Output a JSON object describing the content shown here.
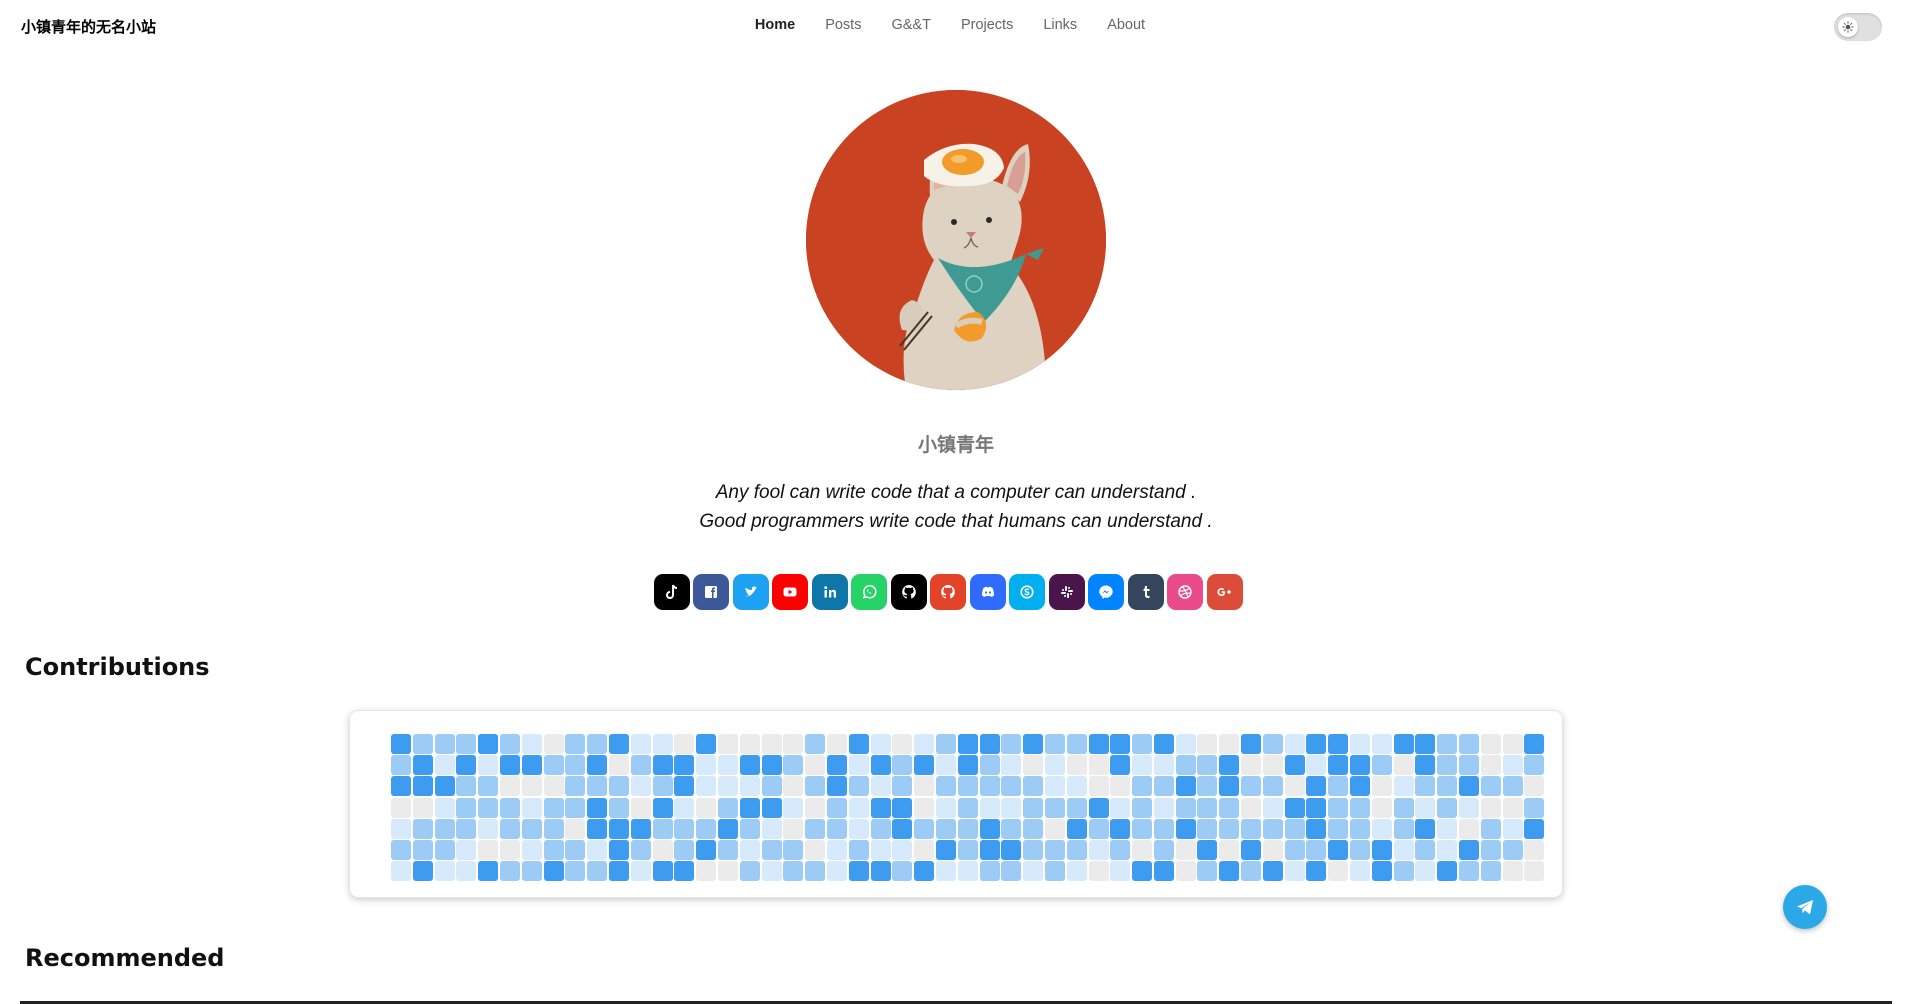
{
  "site": {
    "title": "小镇青年的无名小站"
  },
  "nav": {
    "items": [
      {
        "label": "Home",
        "active": true
      },
      {
        "label": "Posts"
      },
      {
        "label": "G&&T"
      },
      {
        "label": "Projects"
      },
      {
        "label": "Links"
      },
      {
        "label": "About"
      }
    ]
  },
  "theme_toggle": {
    "icon": "sun-icon",
    "state": "light"
  },
  "profile": {
    "name": "小镇青年",
    "motto_line1": "Any fool can write code that a computer can understand .",
    "motto_line2": "Good programmers write code that humans can understand .",
    "avatar_bg": "#c94222"
  },
  "socials": [
    {
      "name": "tiktok",
      "icon": "tiktok-icon",
      "color": "#000000"
    },
    {
      "name": "facebook",
      "icon": "facebook-icon",
      "color": "#3b5998"
    },
    {
      "name": "twitter",
      "icon": "twitter-icon",
      "color": "#1da1f2"
    },
    {
      "name": "youtube",
      "icon": "youtube-icon",
      "color": "#ff0000"
    },
    {
      "name": "linkedin",
      "icon": "linkedin-icon",
      "color": "#0e76a8"
    },
    {
      "name": "whatsapp",
      "icon": "whatsapp-icon",
      "color": "#25d366"
    },
    {
      "name": "github",
      "icon": "github-icon",
      "color": "#000000"
    },
    {
      "name": "gitlab",
      "icon": "gitlab-icon",
      "color": "#e24329"
    },
    {
      "name": "discord",
      "icon": "discord-icon",
      "color": "#2f6bff"
    },
    {
      "name": "skype",
      "icon": "skype-icon",
      "color": "#00aff0"
    },
    {
      "name": "slack",
      "icon": "slack-icon",
      "color": "#4a154b"
    },
    {
      "name": "messenger",
      "icon": "messenger-icon",
      "color": "#0084ff"
    },
    {
      "name": "tumblr",
      "icon": "tumblr-icon",
      "color": "#35465c"
    },
    {
      "name": "dribbble",
      "icon": "dribbble-icon",
      "color": "#ea4c89"
    },
    {
      "name": "google-plus",
      "icon": "google-plus-icon",
      "color": "#dd4b39"
    }
  ],
  "sections": {
    "contributions": "Contributions",
    "recommended": "Recommended"
  },
  "contributions": {
    "levels": [
      "#ebebeb",
      "#d6eafc",
      "#9cccf5",
      "#3d9cf0"
    ],
    "weeks": [
      "3230121",
      "2330223",
      "2131221",
      "2322211",
      "3122103",
      "2302202",
      "1301212",
      "0202223",
      "2222022",
      "2323312",
      "3022333",
      "1210321",
      "1323203",
      "0331223",
      "3110230",
      "0112320",
      "0313212",
      "0323121",
      "0201022",
      "2020202",
      "0332211",
      "3121123",
      "1313213",
      "0223312",
      "1300203",
      "2121231",
      "3322221",
      "3221332",
      "2121232",
      "3022221",
      "2112022",
      "2012321",
      "3003210",
      "3301321",
      "2122203",
      "3121223",
      "1232300",
      "0222232",
      "0332203",
      "3020232",
      "2021203",
      "1303221",
      "3133323",
      "3322230",
      "1332221",
      "1200133",
      "3012212",
      "3321321",
      "2222113",
      "2231032",
      "0020222",
      "0120120",
      "3202300"
    ]
  },
  "fab": {
    "icon": "telegram-icon"
  }
}
